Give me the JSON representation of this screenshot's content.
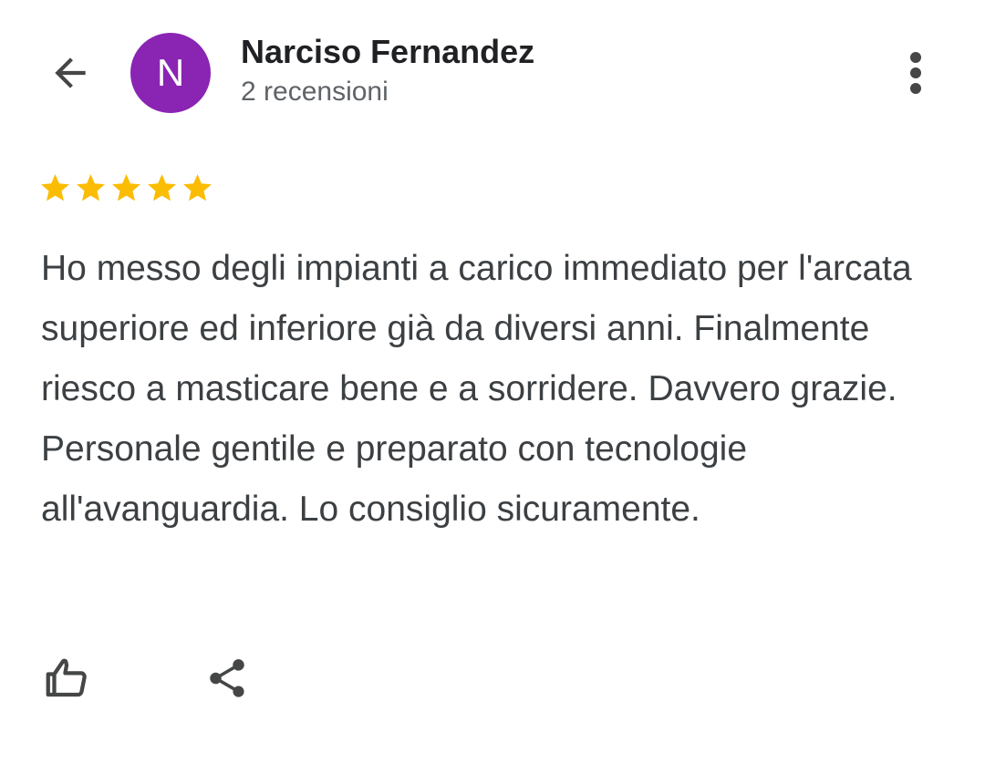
{
  "colors": {
    "avatar_bg": "#8a24b3",
    "star": "#fbbc04",
    "icon": "#444746"
  },
  "header": {
    "back_icon": "arrow-back-icon",
    "avatar_initial": "N",
    "user_name": "Narciso Fernandez",
    "review_count": "2 recensioni",
    "more_icon": "more-vert-icon"
  },
  "review": {
    "rating": 5,
    "rating_max": 5,
    "text": "Ho messo degli impianti a carico immediato per l'arcata superiore ed inferiore già da diversi anni. Finalmente riesco a masticare bene e a sorridere. Davvero grazie. Personale gentile e preparato con tecnologie all'avanguardia. Lo consiglio sicuramente."
  },
  "actions": {
    "like_icon": "thumb-up-icon",
    "share_icon": "share-icon"
  }
}
